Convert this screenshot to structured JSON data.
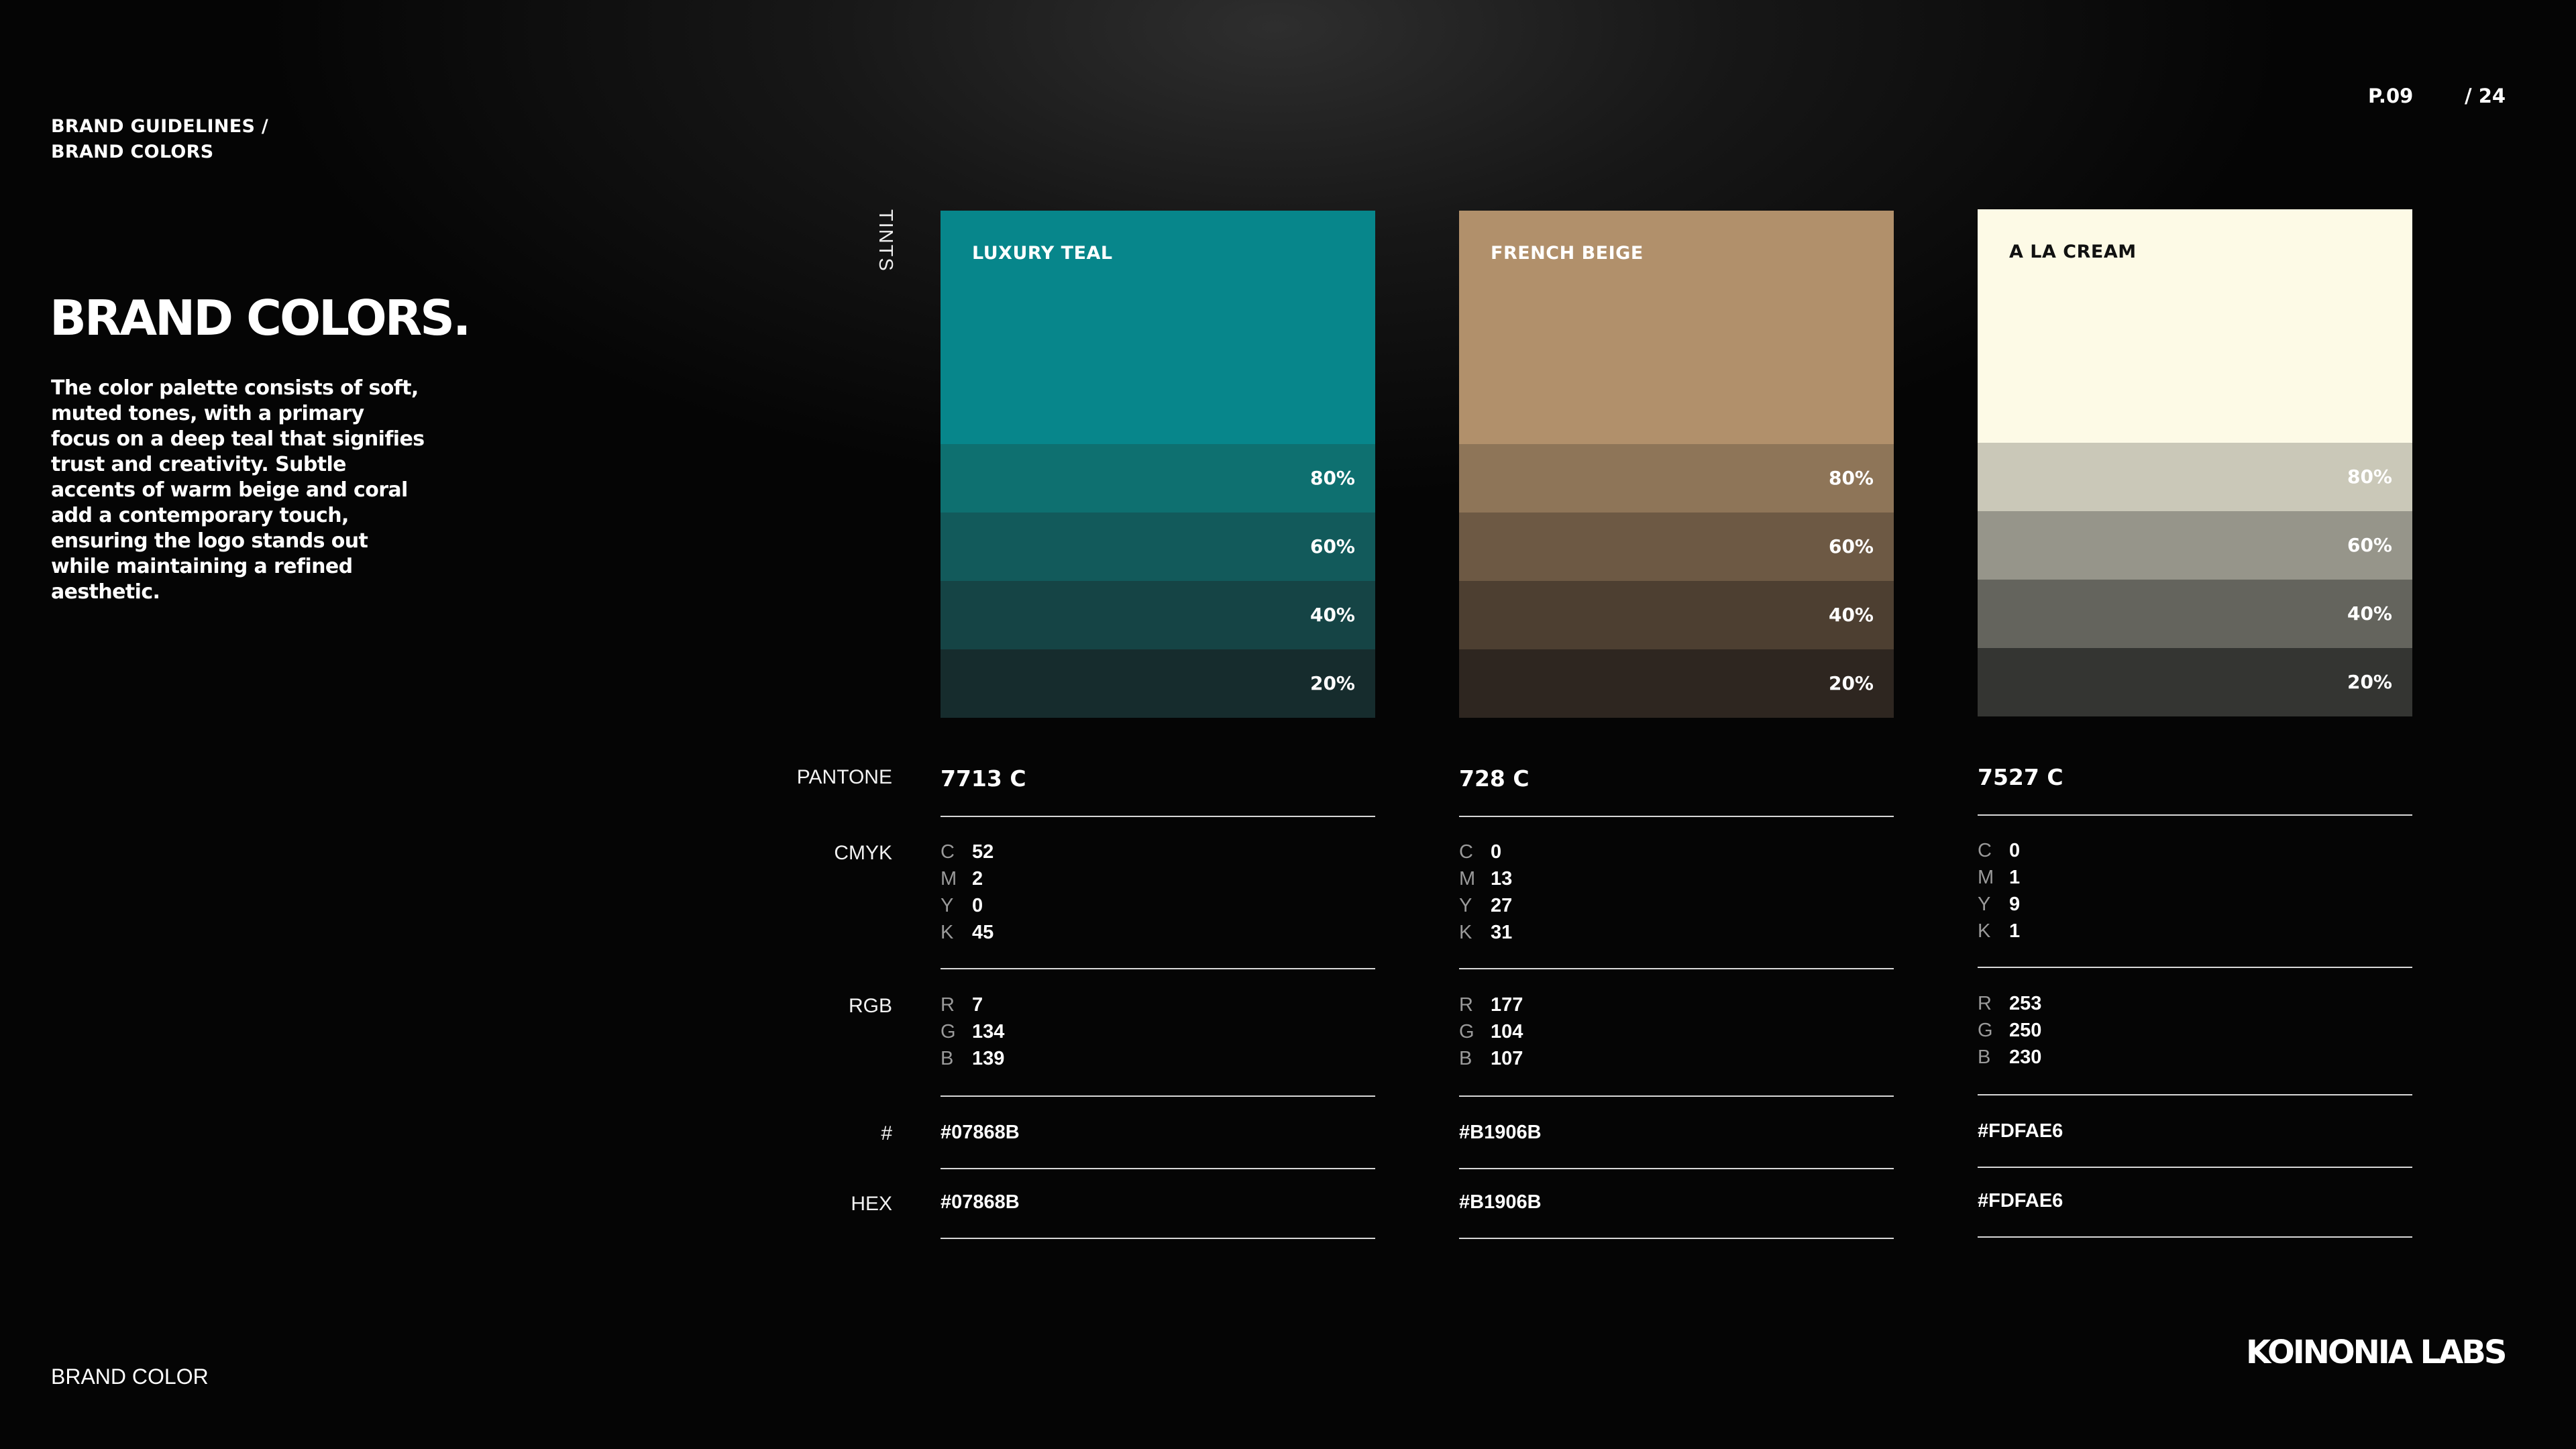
{
  "breadcrumb": {
    "line1": "BRAND GUIDELINES  /",
    "line2": "BRAND COLORS"
  },
  "pager": {
    "page": "P.09",
    "total": "/ 24"
  },
  "title": "BRAND COLORS.",
  "description": "The color palette consists of soft, muted tones, with a primary focus on a deep teal that signifies trust and creativity. Subtle accents of warm beige and coral add a contemporary touch, ensuring the logo stands out while maintaining a refined aesthetic.",
  "tints_label": "TINTS",
  "row_labels": {
    "pantone": "PANTONE",
    "cmyk": "CMYK",
    "rgb": "RGB",
    "hash": "#",
    "hex": "HEX"
  },
  "cmyk_keys": [
    "C",
    "M",
    "Y",
    "K"
  ],
  "rgb_keys": [
    "R",
    "G",
    "B"
  ],
  "swatches": [
    {
      "name": "LUXURY TEAL",
      "name_color": "#ffffff",
      "color": "#07868B",
      "tint_colors": [
        "#0E7070",
        "#125A5B",
        "#154445",
        "#162C2D"
      ],
      "tints": [
        "80%",
        "60%",
        "40%",
        "20%"
      ],
      "pantone": "7713 C",
      "cmyk": [
        "52",
        "2",
        "0",
        "45"
      ],
      "rgb": [
        "7",
        "134",
        "139"
      ],
      "hash": "#07868B",
      "hex": "#07868B"
    },
    {
      "name": "FRENCH BEIGE",
      "name_color": "#ffffff",
      "color": "#B1906B",
      "tint_colors": [
        "#8E7558",
        "#6D5944",
        "#4D3F31",
        "#2E2620"
      ],
      "tints": [
        "80%",
        "60%",
        "40%",
        "20%"
      ],
      "pantone": "728 C",
      "cmyk": [
        "0",
        "13",
        "27",
        "31"
      ],
      "rgb": [
        "177",
        "104",
        "107"
      ],
      "hash": "#B1906B",
      "hex": "#B1906B"
    },
    {
      "name": "A LA CREAM",
      "name_color": "#111111",
      "color": "#FDFAE6",
      "tint_colors": [
        "#CAC8B8",
        "#96958A",
        "#64645D",
        "#343532"
      ],
      "tints": [
        "80%",
        "60%",
        "40%",
        "20%"
      ],
      "pantone": "7527 C",
      "cmyk": [
        "0",
        "1",
        "9",
        "1"
      ],
      "rgb": [
        "253",
        "250",
        "230"
      ],
      "hash": "#FDFAE6",
      "hex": "#FDFAE6"
    }
  ],
  "footer": {
    "left": "BRAND COLOR",
    "logo": "KOINONIA LABS"
  }
}
